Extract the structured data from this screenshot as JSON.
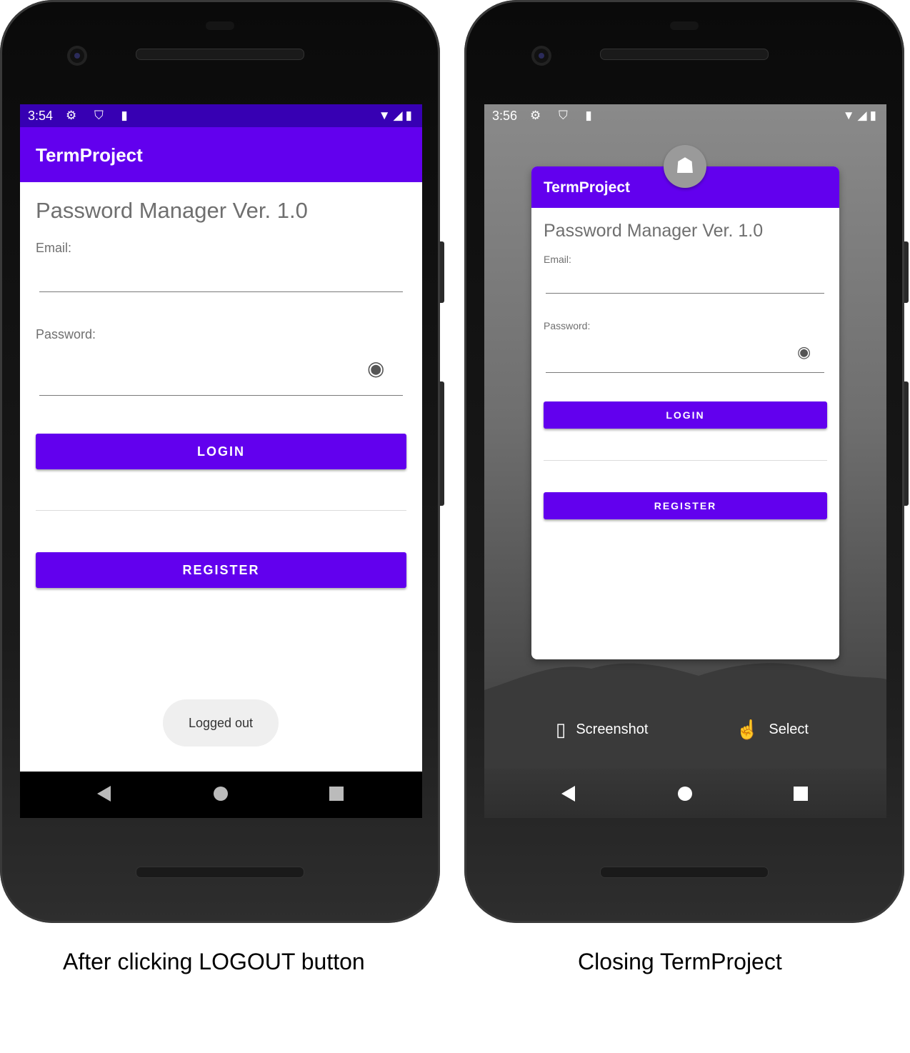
{
  "left_phone": {
    "status": {
      "time": "3:54",
      "left_icons": "⚙ ⛉ ▮",
      "right_icons": "▼◢▮"
    },
    "app_title": "TermProject",
    "heading": "Password Manager Ver. 1.0",
    "email_label": "Email:",
    "password_label": "Password:",
    "eye_icon": "◉",
    "login_label": "LOGIN",
    "register_label": "REGISTER",
    "toast": "Logged out"
  },
  "right_phone": {
    "status": {
      "time": "3:56",
      "left_icons": "⚙ ⛉ ▮",
      "right_icons": "▼◢▮"
    },
    "app_title": "TermProject",
    "heading": "Password Manager Ver. 1.0",
    "email_label": "Email:",
    "password_label": "Password:",
    "eye_icon": "◉",
    "login_label": "LOGIN",
    "register_label": "REGISTER",
    "app_icon": "☗",
    "screenshot_label": "Screenshot",
    "screenshot_icon": "▯",
    "select_label": "Select",
    "select_icon": "☝"
  },
  "captions": {
    "left": "After clicking LOGOUT button",
    "right": "Closing TermProject"
  },
  "colors": {
    "primary": "#6200ee",
    "status_bar": "#3700b3"
  }
}
